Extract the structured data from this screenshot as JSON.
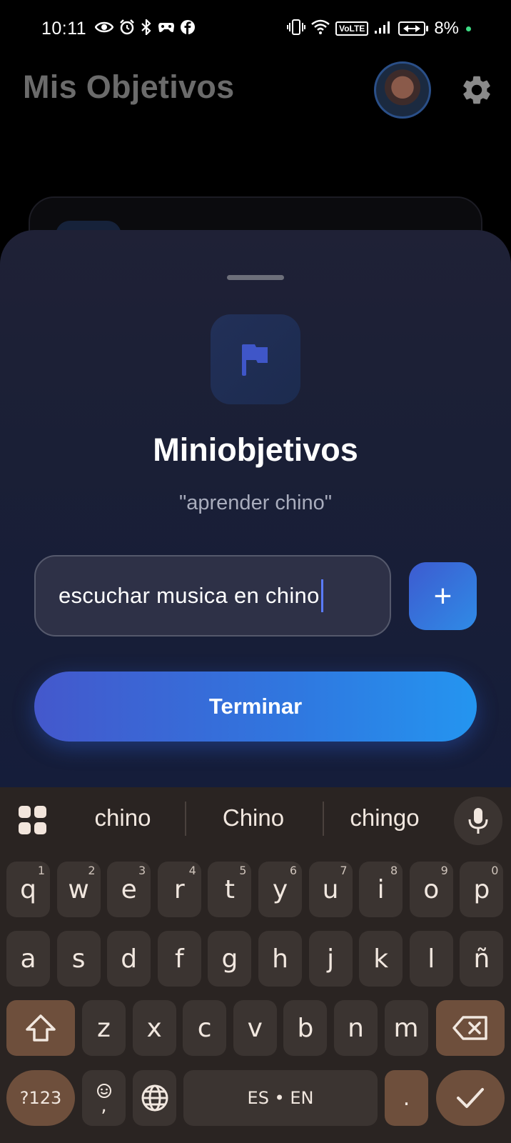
{
  "status_bar": {
    "time": "10:11",
    "left_icons": [
      "eye-icon",
      "alarm-icon",
      "bluetooth-icon",
      "game-controller-icon",
      "facebook-icon"
    ],
    "right_icons": [
      "vibrate-icon",
      "wifi-icon",
      "volte-icon",
      "signal-icon",
      "battery-icon"
    ],
    "volte_label": "VoLTE",
    "battery_percent": "8%",
    "battery_level": 0.08,
    "charging_dot_color": "#3ddc84"
  },
  "header": {
    "title": "Mis Objetivos",
    "avatar": "avatar",
    "settings_icon": "gear-icon"
  },
  "sheet": {
    "icon": "flag-icon",
    "title": "Miniobjetivos",
    "subtitle": "\"aprender chino\"",
    "input": {
      "value": "escuchar musica en chino",
      "placeholder": ""
    },
    "add_button_label": "+",
    "finish_button_label": "Terminar",
    "accent_color": "#2f78e0"
  },
  "keyboard": {
    "suggestions": [
      "chino",
      "Chino",
      "chingo"
    ],
    "row1": [
      {
        "k": "q",
        "h": "1"
      },
      {
        "k": "w",
        "h": "2"
      },
      {
        "k": "e",
        "h": "3"
      },
      {
        "k": "r",
        "h": "4"
      },
      {
        "k": "t",
        "h": "5"
      },
      {
        "k": "y",
        "h": "6"
      },
      {
        "k": "u",
        "h": "7"
      },
      {
        "k": "i",
        "h": "8"
      },
      {
        "k": "o",
        "h": "9"
      },
      {
        "k": "p",
        "h": "0"
      }
    ],
    "row2": [
      "a",
      "s",
      "d",
      "f",
      "g",
      "h",
      "j",
      "k",
      "l",
      "ñ"
    ],
    "row3": [
      "z",
      "x",
      "c",
      "v",
      "b",
      "n",
      "m"
    ],
    "symbols_label": "?123",
    "emoji_comma_label": ",",
    "space_label": "ES • EN",
    "period_label": ".",
    "key_color": "#3b3431",
    "special_key_color": "#6e4f3c",
    "background_color": "#2a2422"
  }
}
